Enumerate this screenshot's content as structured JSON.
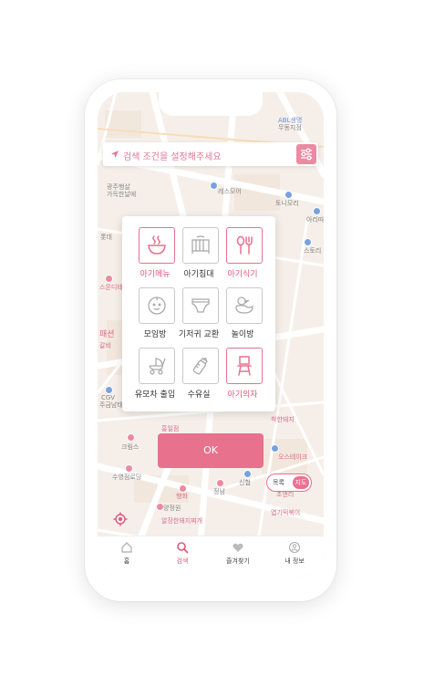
{
  "search": {
    "placeholder_text": "검색 조건을 설정해주세요"
  },
  "map_labels": {
    "l1": "ABL생명",
    "l2": "무동지점",
    "l3": "광주행살",
    "l4": "가득한날에",
    "l5": "레스모어",
    "l6": "토니모리",
    "l7": "아리따",
    "l8": "스토리",
    "l9": "롯데",
    "l10": "스몬디테",
    "l11": "패션",
    "l12": "갈비",
    "l13": "CGV",
    "l14": "주금남태",
    "l15": "착한돼지",
    "l16": "크림스",
    "l17": "홍일점",
    "l18": "오스테이크",
    "l19": "수영점로딩",
    "l20": "행화",
    "l21": "정남",
    "l22": "신협",
    "l23": "양정원",
    "l24": "알장한돼지찌개",
    "l25": "엽기떡볶이",
    "l26": "조앤리"
  },
  "modal": {
    "options": [
      {
        "label": "아기메뉴",
        "icon": "baby-food-bowl-icon",
        "selected": true
      },
      {
        "label": "아기침대",
        "icon": "crib-icon",
        "selected": false
      },
      {
        "label": "아기식기",
        "icon": "baby-cutlery-icon",
        "selected": true
      },
      {
        "label": "모임방",
        "icon": "baby-face-icon",
        "selected": false
      },
      {
        "label": "기저귀 교환",
        "icon": "diaper-icon",
        "selected": false
      },
      {
        "label": "놀이방",
        "icon": "rubber-duck-icon",
        "selected": false
      },
      {
        "label": "유모차 출입",
        "icon": "stroller-icon",
        "selected": false
      },
      {
        "label": "수유실",
        "icon": "baby-bottle-icon",
        "selected": false
      },
      {
        "label": "아기의자",
        "icon": "high-chair-icon",
        "selected": true
      }
    ],
    "ok_label": "OK"
  },
  "toggle": {
    "list_label": "목록",
    "map_label": "지도"
  },
  "nav": {
    "items": [
      {
        "label": "홈",
        "icon": "home-icon"
      },
      {
        "label": "검색",
        "icon": "search-icon"
      },
      {
        "label": "즐겨찾기",
        "icon": "heart-icon"
      },
      {
        "label": "내 정보",
        "icon": "profile-icon"
      }
    ],
    "active_index": 1
  },
  "colors": {
    "accent": "#e8718e",
    "accent_text": "#e2577a",
    "map_bg": "#f4ece4"
  }
}
